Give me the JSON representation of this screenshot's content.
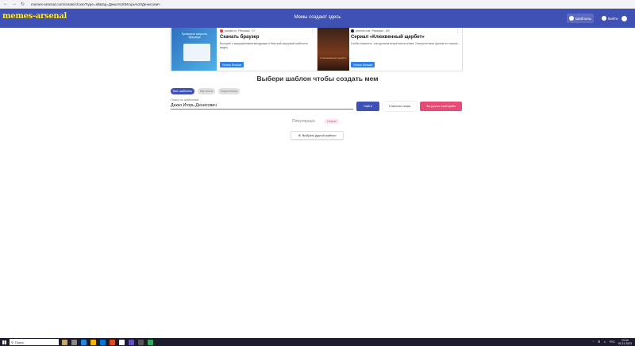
{
  "browser": {
    "url": "memes-arsenal.com/create/chose?type=all&tag=Декко%20Игорь%20Денисович"
  },
  "header": {
    "logo": "memes-arsenal",
    "title": "Мемы создают здесь",
    "templates_label": "Шаблоны",
    "login_label": "Войти"
  },
  "ads": [
    {
      "image_text": "Проверьте скорость браузера",
      "source": "yandex.ru",
      "source_meta": "Реклама · 0+",
      "headline": "Скачать браузер",
      "description": "Быстрее с защищёнными вкладками и быстрой загрузкой шаблон в видео",
      "cta": "Узнать больше"
    },
    {
      "image_text": "Клюквенный щербет",
      "source": "premier.one",
      "source_meta": "Реклама · 18+",
      "headline": "Сериал «Клюквенный щербет»",
      "description": "Чтобы поженить, они должны встретиться снова. Смотрите весь фильм по ссылке...",
      "cta": "Узнать больше"
    }
  ],
  "main": {
    "heading": "Выбери шаблон чтобы создать мем",
    "chips": [
      "Все шаблоны",
      "Картинки",
      "Видеомемы"
    ],
    "search_label": "Поиск по шаблонам",
    "search_value": "Декко Игорь Денисович",
    "find_label": "Найти",
    "clear_label": "Очистить поиск",
    "upload_label": "Загрузить свой файл",
    "tab_popular": "Популярные",
    "tab_new": "Новые",
    "choose_other": "Выбрать другой шаблон"
  },
  "taskbar": {
    "search_placeholder": "Поиск",
    "lang": "РУС",
    "time": "13:43",
    "date": "02.11.2023"
  }
}
